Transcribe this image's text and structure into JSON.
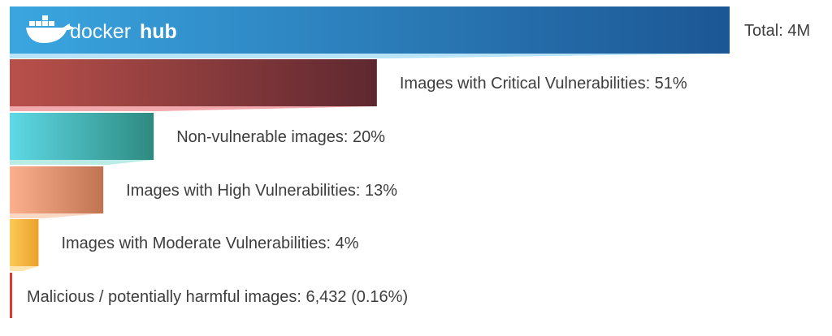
{
  "logo": {
    "text_docker": "docker",
    "text_hub": "hub",
    "icon": "docker-whale-icon"
  },
  "chart_data": {
    "type": "bar",
    "orientation": "horizontal",
    "xlim": [
      0,
      100
    ],
    "bars": [
      {
        "label": "Total: 4M",
        "value": 100,
        "color_start": "#3aa6e0",
        "color_end": "#1c5694",
        "shadow": "#b9e3f6"
      },
      {
        "label": "Images with Critical Vulnerabilities: 51%",
        "value": 51,
        "color_start": "#b9504a",
        "color_end": "#5e2830",
        "shadow": "#f2a9ad"
      },
      {
        "label": "Non-vulnerable images: 20%",
        "value": 20,
        "color_start": "#5ed9e6",
        "color_end": "#2e8a80",
        "shadow": "#b9ece4"
      },
      {
        "label": "Images with High Vulnerabilities: 13%",
        "value": 13,
        "color_start": "#fbb08e",
        "color_end": "#c07351",
        "shadow": "#fbd8c3"
      },
      {
        "label": "Images with Moderate Vulnerabilities: 4%",
        "value": 4,
        "color_start": "#fdc955",
        "color_end": "#e9a12c",
        "shadow": "#fde5b0"
      },
      {
        "label": "Malicious / potentially harmful images: 6,432 (0.16%)",
        "value": 0.16,
        "color_start": "#e03a2f",
        "color_end": "#e03a2f",
        "shadow": "#ffffff"
      }
    ]
  }
}
